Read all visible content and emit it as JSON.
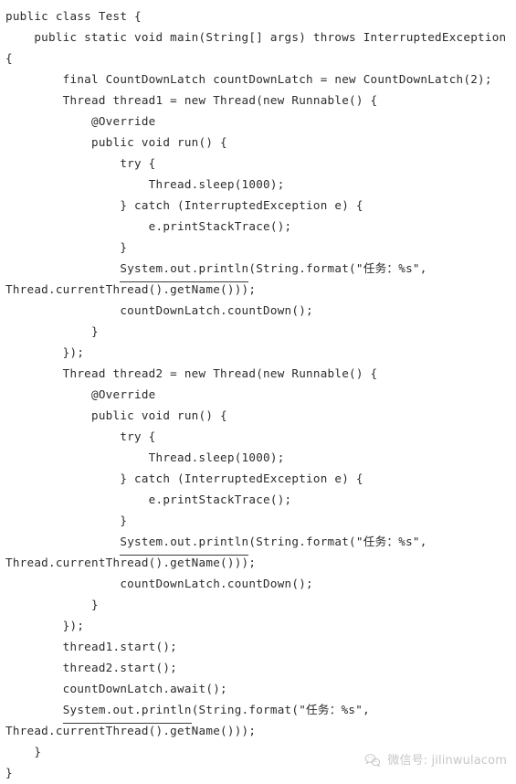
{
  "document": {
    "language": "Java",
    "background_color": "#ffffff",
    "text_color": "#2b2b2b",
    "underline_color": "#cc4444"
  },
  "code": {
    "lines": [
      {
        "text": "public class Test {"
      },
      {
        "text": "    public static void main(String[] args) throws InterruptedException"
      },
      {
        "text": "{"
      },
      {
        "text": "        final CountDownLatch countDownLatch = new CountDownLatch(2);"
      },
      {
        "text": "        Thread thread1 = new Thread(new Runnable() {"
      },
      {
        "text": "            @Override"
      },
      {
        "text": "            public void run() {"
      },
      {
        "text": "                try {"
      },
      {
        "text": "                    Thread.sleep(1000);"
      },
      {
        "text": "                } catch (InterruptedException e) {"
      },
      {
        "text": "                    e.printStackTrace();"
      },
      {
        "text": "                }"
      },
      {
        "pre": "                ",
        "underlined": "System.out.println",
        "post": "(String.format(\"任务：%s\","
      },
      {
        "text": "Thread.currentThread().getName()));"
      },
      {
        "text": "                countDownLatch.countDown();"
      },
      {
        "text": "            }"
      },
      {
        "text": "        });"
      },
      {
        "text": "        Thread thread2 = new Thread(new Runnable() {"
      },
      {
        "text": "            @Override"
      },
      {
        "text": "            public void run() {"
      },
      {
        "text": "                try {"
      },
      {
        "text": "                    Thread.sleep(1000);"
      },
      {
        "text": "                } catch (InterruptedException e) {"
      },
      {
        "text": "                    e.printStackTrace();"
      },
      {
        "text": "                }"
      },
      {
        "pre": "                ",
        "underlined": "System.out.println",
        "post": "(String.format(\"任务：%s\","
      },
      {
        "text": "Thread.currentThread().getName()));"
      },
      {
        "text": "                countDownLatch.countDown();"
      },
      {
        "text": "            }"
      },
      {
        "text": "        });"
      },
      {
        "text": "        thread1.start();"
      },
      {
        "text": "        thread2.start();"
      },
      {
        "text": "        countDownLatch.await();"
      },
      {
        "pre": "        ",
        "underlined": "System.out.println",
        "post": "(String.format(\"任务：%s\","
      },
      {
        "text": "Thread.currentThread().getName()));"
      },
      {
        "text": "    }"
      },
      {
        "text": "}"
      }
    ]
  },
  "watermark": {
    "icon": "wechat-icon",
    "text": "微信号: jilinwulacom"
  }
}
